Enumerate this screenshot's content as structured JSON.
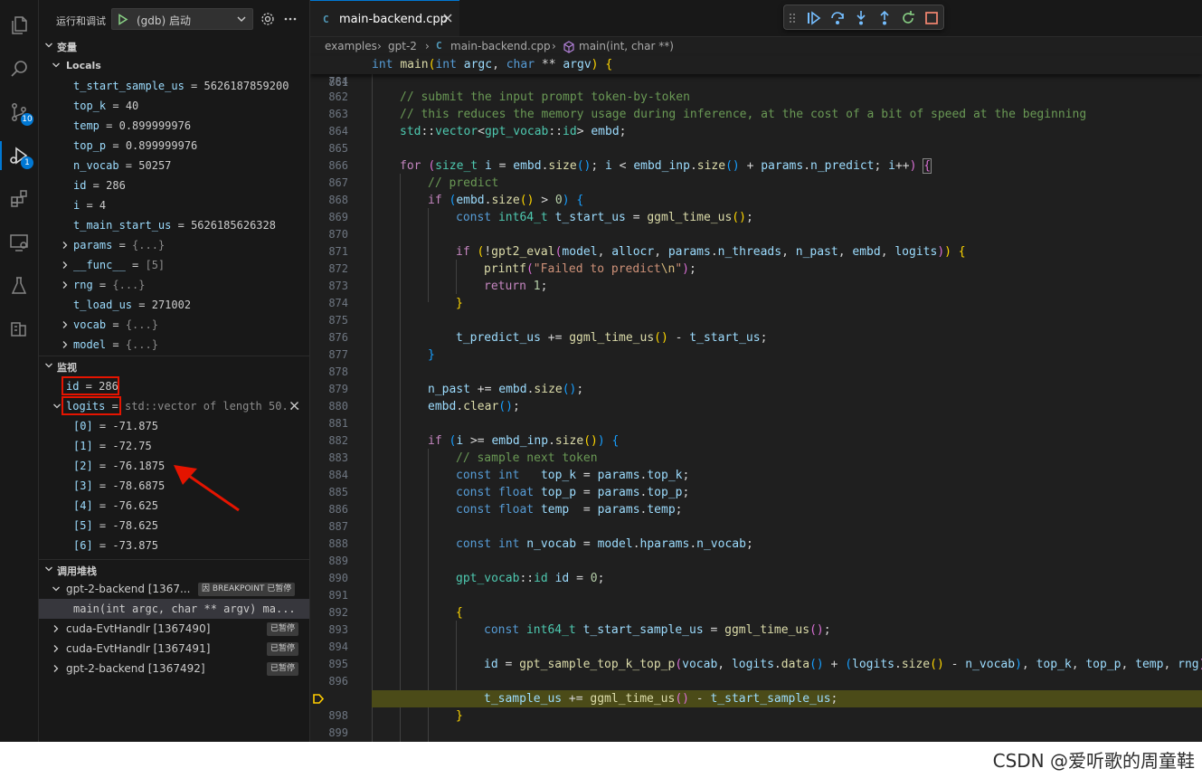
{
  "sidebar": {
    "title": "运行和调试",
    "config_name": "(gdb) 启动",
    "variables_title": "变量",
    "locals_title": "Locals",
    "locals": [
      {
        "name": "t_start_sample_us",
        "value": "5626187859200"
      },
      {
        "name": "top_k",
        "value": "40"
      },
      {
        "name": "temp",
        "value": "0.899999976"
      },
      {
        "name": "top_p",
        "value": "0.899999976"
      },
      {
        "name": "n_vocab",
        "value": "50257"
      },
      {
        "name": "id",
        "value": "286"
      },
      {
        "name": "i",
        "value": "4"
      },
      {
        "name": "t_main_start_us",
        "value": "5626185626328"
      },
      {
        "name": "params",
        "value": "{...}"
      },
      {
        "name": "__func__",
        "value": "[5]"
      },
      {
        "name": "rng",
        "value": "{...}"
      },
      {
        "name": "t_load_us",
        "value": "271002"
      },
      {
        "name": "vocab",
        "value": "{...}"
      },
      {
        "name": "model",
        "value": "{...}"
      }
    ],
    "watch_title": "监视",
    "watch": {
      "id_name": "id",
      "id_value": "286",
      "logits_name": "logits",
      "logits_value": "std::vector of length 50...",
      "items": [
        {
          "name": "[0]",
          "value": "-71.875"
        },
        {
          "name": "[1]",
          "value": "-72.75"
        },
        {
          "name": "[2]",
          "value": "-76.1875"
        },
        {
          "name": "[3]",
          "value": "-78.6875"
        },
        {
          "name": "[4]",
          "value": "-76.625"
        },
        {
          "name": "[5]",
          "value": "-78.625"
        },
        {
          "name": "[6]",
          "value": "-73.875"
        }
      ]
    },
    "callstack_title": "调用堆栈",
    "callstack": {
      "thread1": "gpt-2-backend [1367...",
      "thread1_badge": "因 BREAKPOINT 已暂停",
      "frame": "main(int argc, char ** argv)  ma...",
      "thread2": "cuda-EvtHandlr [1367490]",
      "thread3": "cuda-EvtHandlr [1367491]",
      "thread4": "gpt-2-backend [1367492]",
      "paused": "已暂停"
    },
    "badges": {
      "scm": "10",
      "debug": "1"
    }
  },
  "editor": {
    "tab_label": "main-backend.cpp",
    "tab_icon": "C",
    "breadcrumb": {
      "p1": "examples",
      "p2": "gpt-2",
      "p3": "main-backend.cpp",
      "p4": "main(int, char **)"
    },
    "sticky_line": "784",
    "lines": [
      "861",
      "862",
      "863",
      "864",
      "865",
      "866",
      "867",
      "868",
      "869",
      "870",
      "871",
      "872",
      "873",
      "874",
      "875",
      "876",
      "877",
      "878",
      "879",
      "880",
      "881",
      "882",
      "883",
      "884",
      "885",
      "886",
      "887",
      "888",
      "889",
      "890",
      "891",
      "892",
      "893",
      "894",
      "895",
      "896",
      "897",
      "898",
      "899"
    ],
    "current_line": "897",
    "tokens": {
      "int": "int",
      "main": "main",
      "argc": "argc",
      "char": "char",
      "argv": "argv",
      "c862": "// submit the input prompt token-by-token",
      "c863": "// this reduces the memory usage during inference, at the cost of a bit of speed at the beginning",
      "std": "std",
      "vector": "vector",
      "gpt_vocab": "gpt_vocab",
      "id_t": "id",
      "embd": "embd",
      "for": "for",
      "size_t": "size_t",
      "i": "i",
      "size": "size",
      "embd_inp": "embd_inp",
      "params": "params",
      "n_predict": "n_predict",
      "c867": "// predict",
      "if": "if",
      "zero": "0",
      "const": "const",
      "int64_t": "int64_t",
      "t_start_us": "t_start_us",
      "ggml_time_us": "ggml_time_us",
      "gpt2_eval": "gpt2_eval",
      "model": "model",
      "allocr": "allocr",
      "n_threads": "n_threads",
      "n_past": "n_past",
      "logits": "logits",
      "printf": "printf",
      "str1": "\"Failed to predict",
      "esc": "\\n",
      "str2": "\"",
      "return": "return",
      "one": "1",
      "t_predict_us": "t_predict_us",
      "clear": "clear",
      "c883": "// sample next token",
      "top_k": "top_k",
      "float": "float",
      "top_p": "top_p",
      "temp": "temp",
      "n_vocab": "n_vocab",
      "hparams": "hparams",
      "id": "id",
      "t_start_sample_us": "t_start_sample_us",
      "gpt_sample_top_k_top_p": "gpt_sample_top_k_top_p",
      "vocab": "vocab",
      "data": "data",
      "rng": "rng",
      "t_sample_us": "t_sample_us"
    }
  },
  "watermark": "CSDN @爱听歌的周童鞋",
  "colors": {
    "accent": "#0078d4",
    "highlight_box": "#e51400",
    "arrow": "#e51400",
    "current_line": "#4b4b18"
  }
}
